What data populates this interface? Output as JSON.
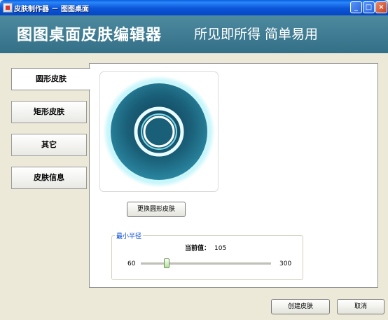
{
  "window": {
    "title": "皮肤制作器 － 图图桌面",
    "minimize_glyph": "_",
    "maximize_glyph": "□",
    "close_glyph": "×"
  },
  "banner": {
    "title": "图图桌面皮肤编辑器",
    "slogan": "所见即所得  简单易用"
  },
  "tabs": [
    {
      "label": "圆形皮肤",
      "active": true
    },
    {
      "label": "矩形皮肤",
      "active": false
    },
    {
      "label": "其它",
      "active": false
    },
    {
      "label": "皮肤信息",
      "active": false
    }
  ],
  "preview": {
    "change_button": "更换圆形皮肤"
  },
  "radius": {
    "group_title": "最小半径",
    "current_label": "当前值：",
    "current_value": "105",
    "min": "60",
    "max": "300",
    "slider_value": 105
  },
  "footer": {
    "create_button": "创建皮肤",
    "cancel_button": "取消"
  },
  "colors": {
    "banner": "#3f7f96",
    "titlebar": "#0a55d8",
    "disc_outer": "#1f6e86",
    "disc_glow": "#6fe7f5"
  }
}
